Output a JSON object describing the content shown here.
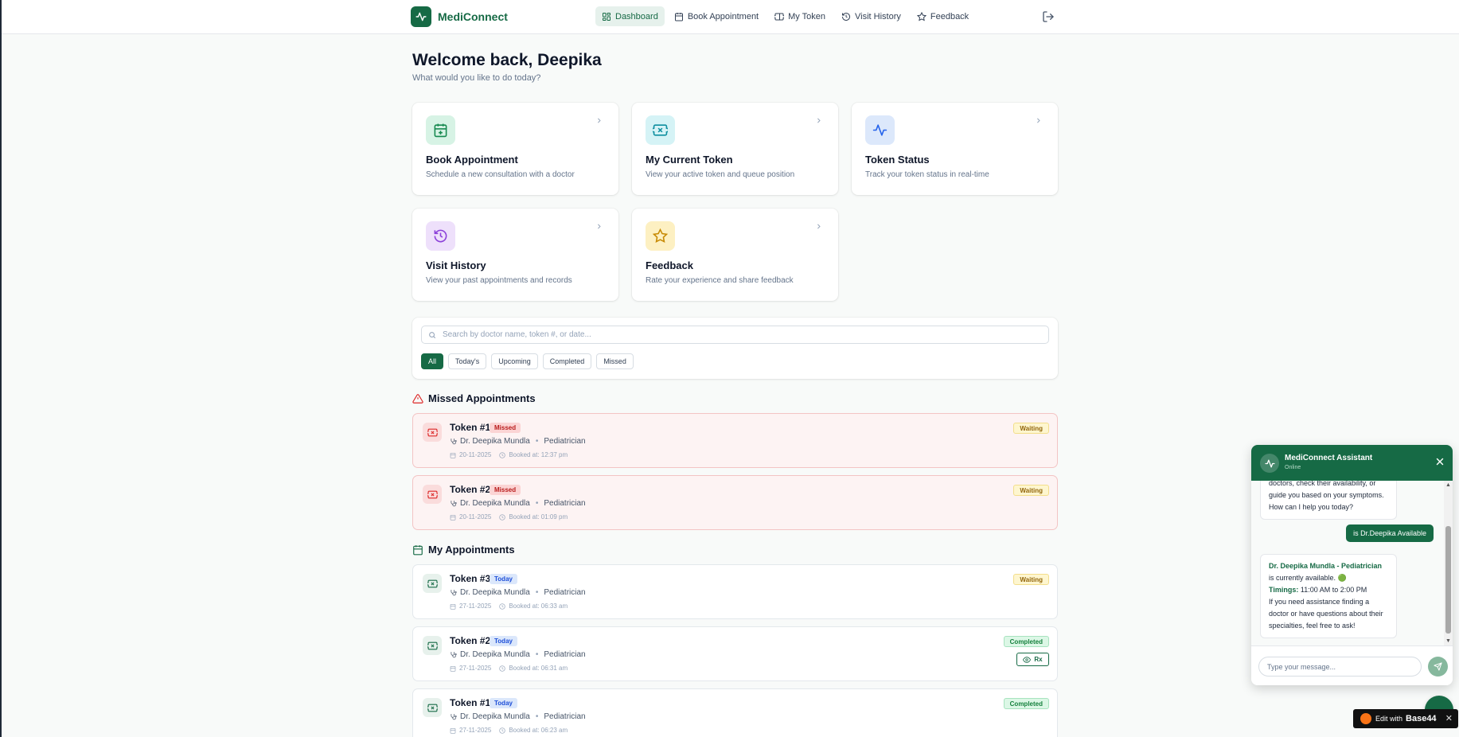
{
  "app": {
    "name": "MediConnect",
    "brand_color": "#166a45"
  },
  "nav": [
    {
      "label": "Dashboard",
      "icon": "grid-icon",
      "active": true
    },
    {
      "label": "Book Appointment",
      "icon": "calendar-icon"
    },
    {
      "label": "My Token",
      "icon": "ticket-icon"
    },
    {
      "label": "Visit History",
      "icon": "history-icon"
    },
    {
      "label": "Feedback",
      "icon": "star-icon"
    }
  ],
  "header": {
    "welcome": "Welcome back, Deepika",
    "subtitle": "What would you like to do today?"
  },
  "cards": [
    {
      "title": "Book Appointment",
      "desc": "Schedule a new consultation with a doctor",
      "icon": "calendar-plus-icon"
    },
    {
      "title": "My Current Token",
      "desc": "View your active token and queue position",
      "icon": "ticket-icon"
    },
    {
      "title": "Token Status",
      "desc": "Track your token status in real-time",
      "icon": "activity-icon"
    },
    {
      "title": "Visit History",
      "desc": "View your past appointments and records",
      "icon": "history-icon"
    },
    {
      "title": "Feedback",
      "desc": "Rate your experience and share feedback",
      "icon": "star-icon"
    }
  ],
  "search": {
    "placeholder": "Search by doctor name, token #, or date..."
  },
  "filters": [
    "All",
    "Today's",
    "Upcoming",
    "Completed",
    "Missed"
  ],
  "sections": {
    "missed": "Missed Appointments",
    "mine": "My Appointments"
  },
  "missed_appointments": [
    {
      "token": "Token #1",
      "tag": "Missed",
      "doctor": "Dr. Deepika Mundla",
      "specialty": "Pediatrician",
      "date": "20-11-2025",
      "booked": "Booked at: 12:37 pm",
      "status": "Waiting"
    },
    {
      "token": "Token #2",
      "tag": "Missed",
      "doctor": "Dr. Deepika Mundla",
      "specialty": "Pediatrician",
      "date": "20-11-2025",
      "booked": "Booked at: 01:09 pm",
      "status": "Waiting"
    }
  ],
  "my_appointments": [
    {
      "token": "Token #3",
      "tag": "Today",
      "doctor": "Dr. Deepika Mundla",
      "specialty": "Pediatrician",
      "date": "27-11-2025",
      "booked": "Booked at: 06:33 am",
      "status": "Waiting"
    },
    {
      "token": "Token #2",
      "tag": "Today",
      "doctor": "Dr. Deepika Mundla",
      "specialty": "Pediatrician",
      "date": "27-11-2025",
      "booked": "Booked at: 06:31 am",
      "status": "Completed",
      "rx": "Rx"
    },
    {
      "token": "Token #1",
      "tag": "Today",
      "doctor": "Dr. Deepika Mundla",
      "specialty": "Pediatrician",
      "date": "27-11-2025",
      "booked": "Booked at: 06:23 am",
      "status": "Completed"
    }
  ],
  "chat": {
    "title": "MediConnect Assistant",
    "status": "Online",
    "bot_msg_1": "doctors, check their availability, or guide you based on your symptoms. How can I help you today?",
    "user_msg": "is Dr.Deepika Available",
    "bot_msg_2_name": "Dr. Deepika Mundla - Pediatrician",
    "bot_msg_2_avail": "is currently available. 🟢",
    "bot_msg_2_timings_label": "Timings:",
    "bot_msg_2_timings": "11:00 AM to 2:00 PM",
    "bot_msg_2_help": "If you need assistance finding a doctor or have questions about their specialties, feel free to ask!",
    "input_placeholder": "Type your message..."
  },
  "edit_badge": {
    "text": "Edit with",
    "brand": "Base44",
    "close": "✕"
  }
}
